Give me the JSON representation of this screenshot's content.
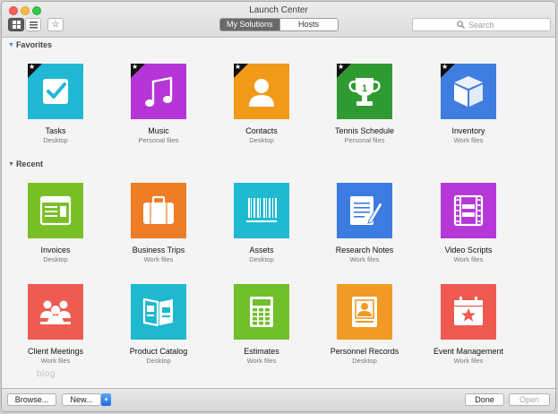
{
  "window": {
    "title": "Launch Center"
  },
  "toolbar": {
    "view_segments": [
      "My Solutions",
      "Hosts"
    ],
    "selected_segment": "My Solutions",
    "search_placeholder": "Search"
  },
  "sections": {
    "favorites_label": "Favorites",
    "recent_label": "Recent"
  },
  "favorites": [
    {
      "name": "Tasks",
      "location": "Desktop",
      "color": "#21b8d6",
      "icon": "checkbox-icon",
      "favorite": true
    },
    {
      "name": "Music",
      "location": "Personal files",
      "color": "#b535d6",
      "icon": "music-note-icon",
      "favorite": true
    },
    {
      "name": "Contacts",
      "location": "Desktop",
      "color": "#f09a18",
      "icon": "person-silhouette-icon",
      "favorite": true
    },
    {
      "name": "Tennis Schedule",
      "location": "Personal files",
      "color": "#2f9a32",
      "icon": "trophy-icon",
      "trophy_text": "1",
      "favorite": true
    },
    {
      "name": "Inventory",
      "location": "Work files",
      "color": "#3f7de0",
      "icon": "box-icon",
      "favorite": true
    }
  ],
  "recent": [
    {
      "name": "Invoices",
      "location": "Desktop",
      "color": "#78c026",
      "icon": "invoice-window-icon"
    },
    {
      "name": "Business Trips",
      "location": "Work files",
      "color": "#ee7d25",
      "icon": "suitcase-icon"
    },
    {
      "name": "Assets",
      "location": "Desktop",
      "color": "#1fbad2",
      "icon": "barcode-icon"
    },
    {
      "name": "Research Notes",
      "location": "Work files",
      "color": "#3c7be0",
      "icon": "notepad-pencil-icon"
    },
    {
      "name": "Video Scripts",
      "location": "Work files",
      "color": "#b537d8",
      "icon": "film-strip-icon"
    },
    {
      "name": "Client Meetings",
      "location": "Work files",
      "color": "#ee5b52",
      "icon": "people-group-icon"
    },
    {
      "name": "Product Catalog",
      "location": "Desktop",
      "color": "#1fb8cf",
      "icon": "catalog-book-icon"
    },
    {
      "name": "Estimates",
      "location": "Work files",
      "color": "#70bf2b",
      "icon": "calculator-icon"
    },
    {
      "name": "Personnel Records",
      "location": "Desktop",
      "color": "#f19a25",
      "icon": "id-badge-icon"
    },
    {
      "name": "Event Management",
      "location": "Work files",
      "color": "#ee5a52",
      "icon": "calendar-star-icon"
    }
  ],
  "watermark": "blog",
  "bottombar": {
    "browse_label": "Browse...",
    "new_label": "New...",
    "done_label": "Done",
    "open_label": "Open"
  }
}
